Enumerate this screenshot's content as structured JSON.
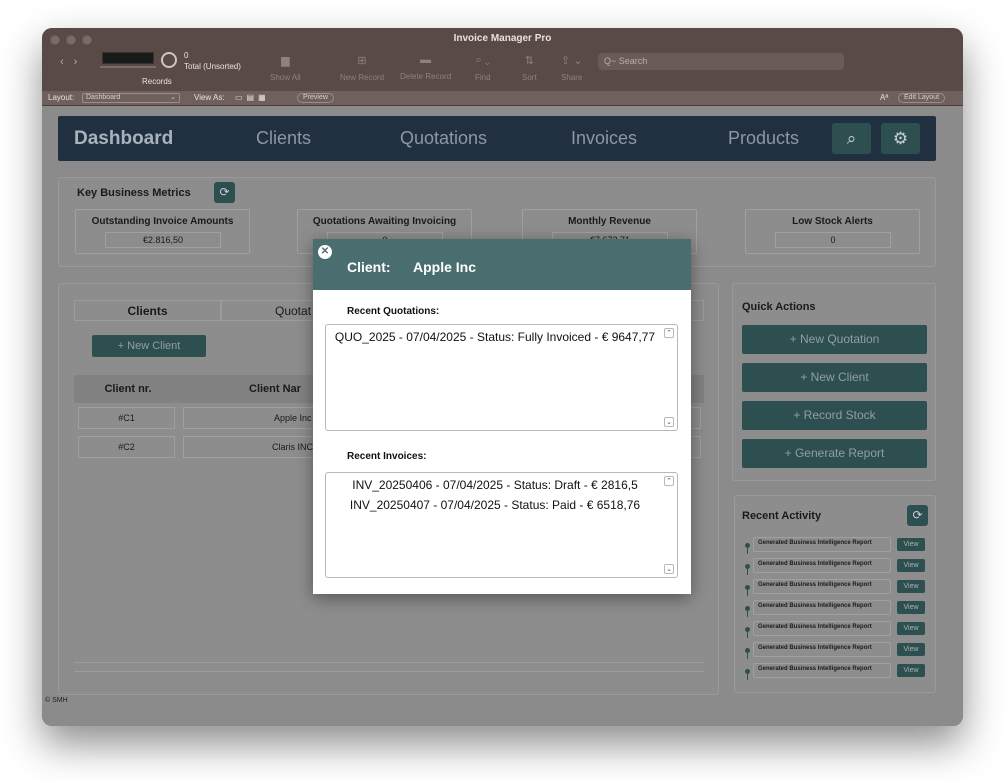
{
  "window": {
    "title": "Invoice Manager Pro"
  },
  "toolbar": {
    "record_count": "0",
    "record_total": "Total (Unsorted)",
    "records_label": "Records",
    "show_all": "Show All",
    "new_record": "New Record",
    "delete_record": "Delete Record",
    "find": "Find",
    "sort": "Sort",
    "share": "Share",
    "search_placeholder": "Q~ Search"
  },
  "layout_bar": {
    "layout_label": "Layout:",
    "layout_value": "Dashboard",
    "view_as": "View As:",
    "preview": "Preview",
    "edit_layout": "Edit Layout"
  },
  "nav": {
    "items": [
      "Dashboard",
      "Clients",
      "Quotations",
      "Invoices",
      "Products"
    ],
    "active": "Dashboard"
  },
  "metrics": {
    "title": "Key Business Metrics",
    "cards": [
      {
        "label": "Outstanding Invoice Amounts",
        "value": "€2.816,50"
      },
      {
        "label": "Quotations Awaiting Invoicing",
        "value": "0"
      },
      {
        "label": "Monthly Revenue",
        "value": "€7.672,71"
      },
      {
        "label": "Low Stock Alerts",
        "value": "0"
      }
    ]
  },
  "clients_panel": {
    "tabs": [
      "Clients",
      "Quotat"
    ],
    "new_client": "+ New Client",
    "columns": [
      "Client nr.",
      "Client Nar"
    ],
    "rows": [
      {
        "nr": "#C1",
        "name": "Apple Inc"
      },
      {
        "nr": "#C2",
        "name": "Claris INC"
      }
    ]
  },
  "quick_actions": {
    "title": "Quick Actions",
    "buttons": [
      "+ New Quotation",
      "+ New Client",
      "+ Record Stock",
      "+ Generate Report"
    ]
  },
  "recent_activity": {
    "title": "Recent Activity",
    "items": [
      "Generated Business Intelligence Report",
      "Generated Business Intelligence Report",
      "Generated Business Intelligence Report",
      "Generated Business Intelligence Report",
      "Generated Business Intelligence Report",
      "Generated Business Intelligence Report",
      "Generated Business Intelligence Report"
    ],
    "view_label": "View"
  },
  "footer": "© SMH",
  "modal": {
    "title_label": "Client:",
    "client_name": "Apple Inc",
    "quotations_label": "Recent Quotations:",
    "quotations": [
      "QUO_2025 - 07/04/2025 - Status: Fully Invoiced - € 9647,77"
    ],
    "invoices_label": "Recent Invoices:",
    "invoices": [
      "INV_20250406 - 07/04/2025 - Status: Draft - € 2816,5",
      "INV_20250407 - 07/04/2025 - Status: Paid - € 6518,76"
    ]
  }
}
